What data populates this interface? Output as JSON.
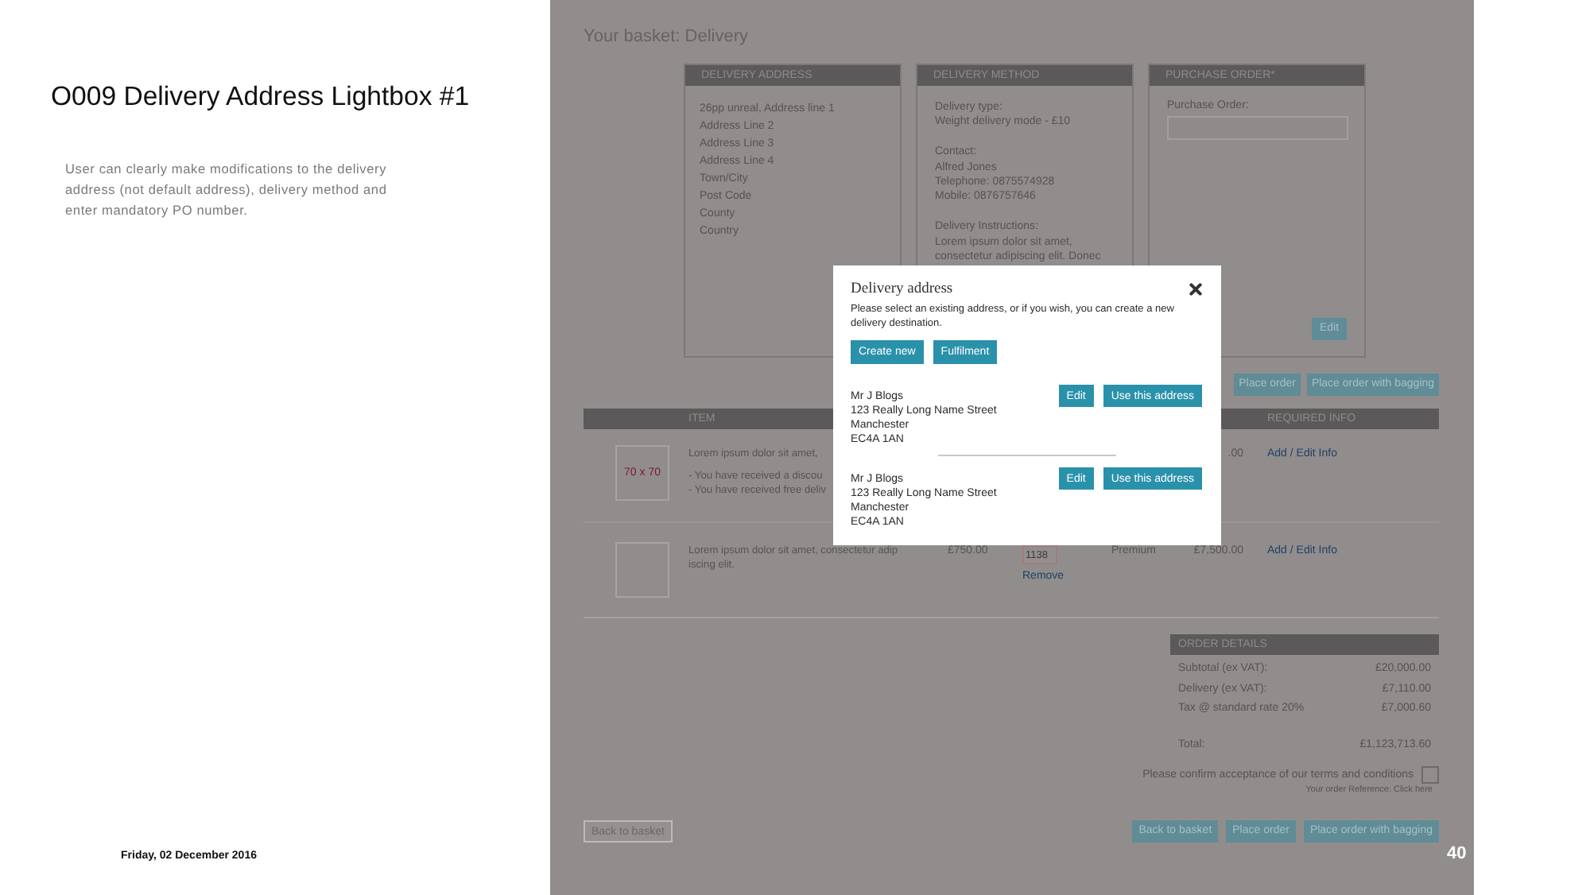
{
  "slide": {
    "title": "O009 Delivery Address Lightbox #1",
    "description": "User can clearly make modifications to the delivery address (not default address), delivery method and enter mandatory PO number.",
    "date": "Friday, 02 December 2016",
    "page_number": "40"
  },
  "page": {
    "heading": "Your basket: Delivery",
    "cards": [
      {
        "kind": "address",
        "title": "DELIVERY ADDRESS",
        "groups": [
          [
            "26pp unreal, Address line 1",
            "Address Line 2",
            "Address Line 3",
            "Address Line 4",
            "Town/City",
            "Post Code",
            "County",
            "Country"
          ]
        ]
      },
      {
        "kind": "method",
        "title": "DELIVERY METHOD",
        "groups": [
          [
            "Delivery type:",
            "Weight delivery mode - £10"
          ],
          [
            "Contact:",
            "Alfred Jones",
            "Telephone: 0875574928",
            "Mobile: 0876757646"
          ],
          [
            "Delivery Instructions:",
            "Lorem ipsum dolor sit amet,",
            "consectetur adipiscing elit. Donec"
          ]
        ]
      },
      {
        "kind": "purchase_order",
        "title": "PURCHASE ORDER*",
        "field_label": "Purchase Order:",
        "button": "Edit"
      }
    ],
    "top_buttons": [
      "Place order",
      "Place order with bagging"
    ],
    "table": {
      "columns": [
        "ITEM",
        "REQUIRED INFO"
      ],
      "rows": [
        {
          "thumbnail_label": "70 x 70",
          "description": "Lorem ipsum dolor sit amet,",
          "notes": [
            "- You have received a discou",
            "- You have received free deliv"
          ],
          "total": ".00",
          "info_link": "Add / Edit Info"
        },
        {
          "description": "Lorem ipsum dolor sit amet, consectetur adip iscing elit.",
          "price": "£750.00",
          "quantity": "1138",
          "remove_link": "Remove",
          "column_5": "Premium",
          "total": "£7,500.00",
          "info_link": "Add / Edit Info"
        }
      ]
    },
    "order_details": {
      "title": "ORDER DETAILS",
      "lines": [
        {
          "label": "Subtotal (ex VAT):",
          "value": "£20,000.00"
        },
        {
          "label": "Delivery (ex VAT):",
          "value": "£7,110.00"
        },
        {
          "label": "Tax @ standard rate 20%",
          "value": "£7,000.60"
        }
      ],
      "total": {
        "label": "Total:",
        "value": "£1,123,713.60"
      },
      "terms": {
        "label": "Please confirm acceptance of our terms and conditions",
        "checked": false
      },
      "reference": "Your order Reference: Click here"
    },
    "back_button": "Back to basket",
    "bottom_buttons": [
      "Back to basket",
      "Place order",
      "Place order with bagging"
    ]
  },
  "modal": {
    "title": "Delivery address",
    "intro": "Please select an existing address, or if you wish, you can create a new delivery destination.",
    "buttons": [
      "Create new",
      "Fulfilment"
    ],
    "addresses": [
      {
        "lines": [
          "Mr J Blogs",
          "123 Really Long Name Street",
          "Manchester",
          "EC4A 1AN"
        ],
        "buttons": [
          "Edit",
          "Use this address"
        ]
      },
      {
        "lines": [
          "Mr J Blogs",
          "123 Really Long Name Street",
          "Manchester",
          "EC4A 1AN"
        ],
        "buttons": [
          "Edit",
          "Use this address"
        ]
      }
    ]
  }
}
